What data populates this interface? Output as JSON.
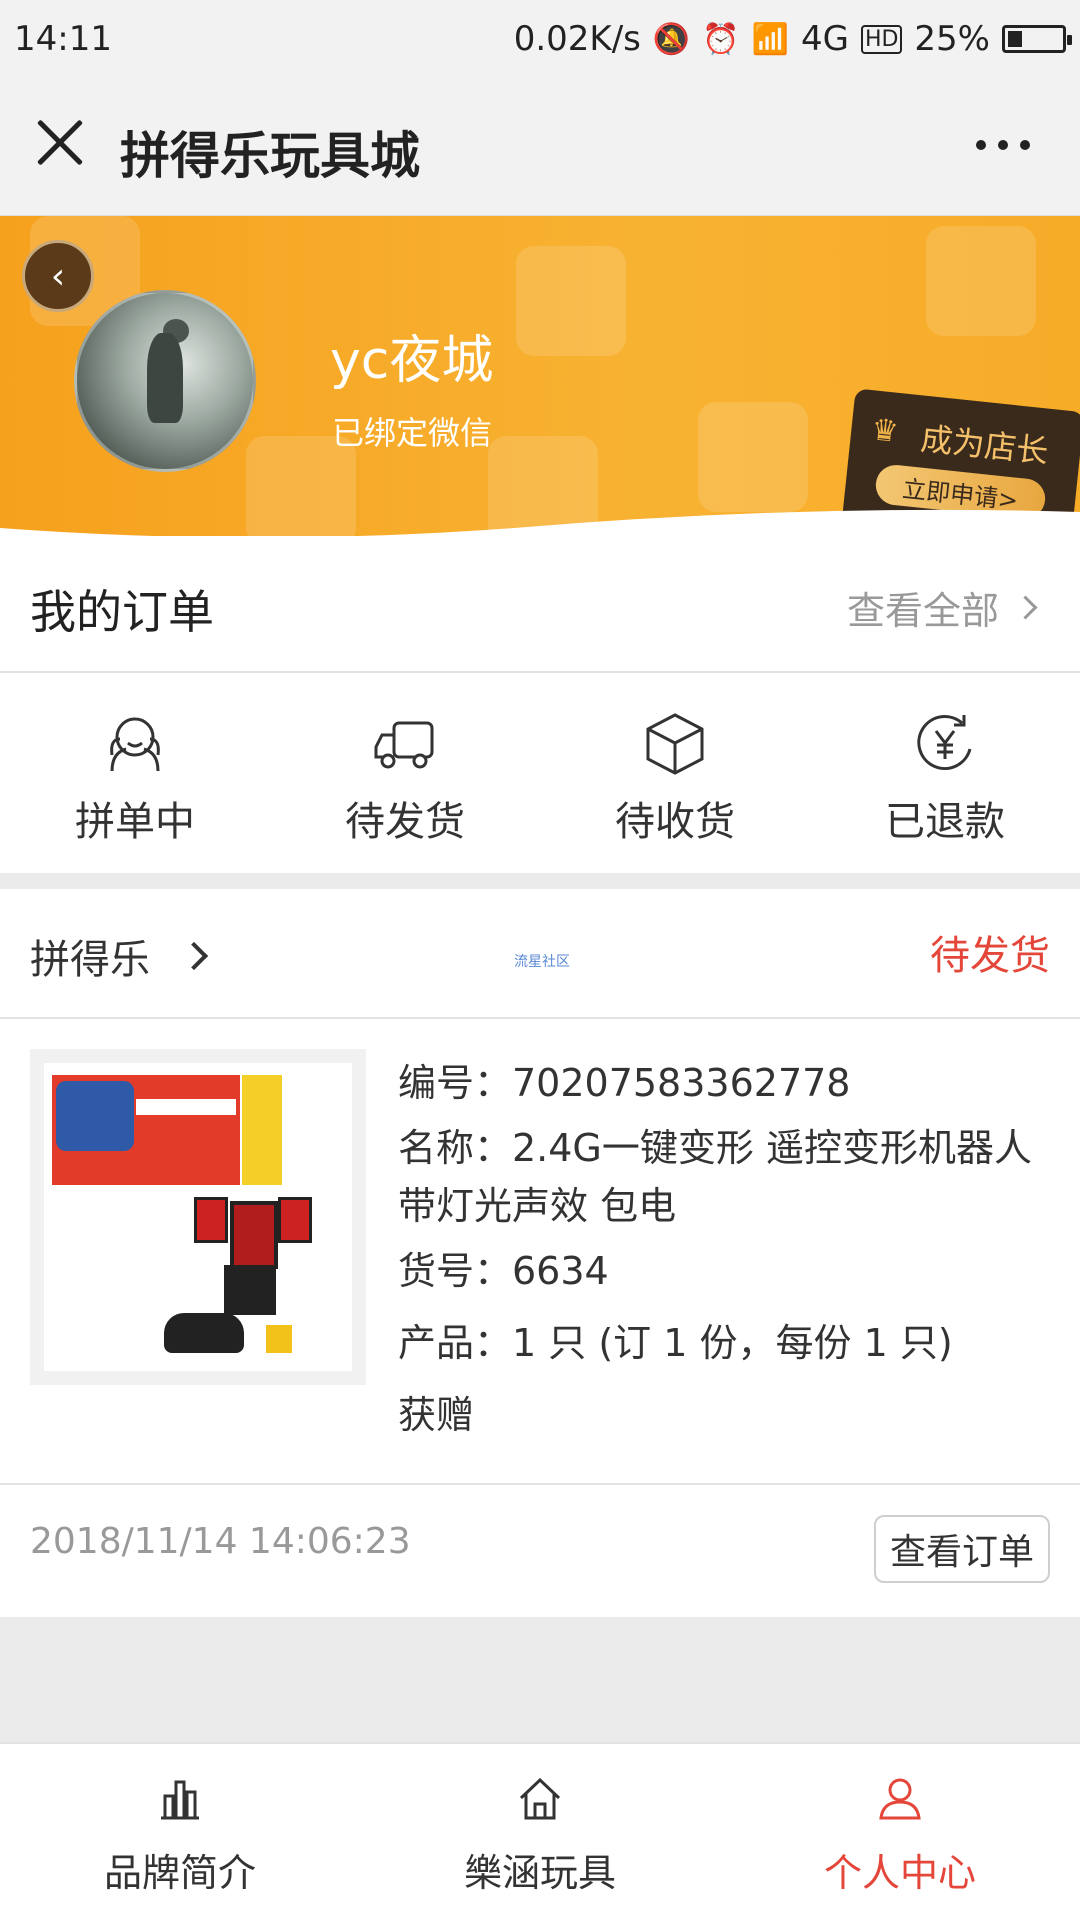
{
  "status_bar": {
    "time": "14:11",
    "speed": "0.02K/s",
    "network": "4G",
    "hd": "HD",
    "battery": "25%"
  },
  "nav": {
    "title": "拼得乐玩具城"
  },
  "profile": {
    "username": "yc夜城",
    "bound_text": "已绑定微信",
    "shop_promo_title": "成为店长",
    "shop_promo_button": "立即申请>"
  },
  "orders": {
    "title": "我的订单",
    "view_all": "查看全部",
    "tabs": [
      {
        "label": "拼单中",
        "icon": "group-buy-icon"
      },
      {
        "label": "待发货",
        "icon": "truck-icon"
      },
      {
        "label": "待收货",
        "icon": "package-icon"
      },
      {
        "label": "已退款",
        "icon": "refund-icon"
      }
    ]
  },
  "order_item": {
    "shop": "拼得乐",
    "watermark": "流星社区",
    "status": "待发货",
    "number": "编号：70207583362778",
    "name_line1": "名称：2.4G一键变形 遥控变形机器人",
    "name_line2": "带灯光声效 包电",
    "sku": "货号：6634",
    "quantity": "产品：1 只 (订 1 份，每份 1 只)",
    "gift": "获赠",
    "date": "2018/11/14 14:06:23",
    "view_order": "查看订单"
  },
  "tabbar": {
    "items": [
      {
        "label": "品牌简介",
        "icon": "chart-icon",
        "active": false
      },
      {
        "label": "樂涵玩具",
        "icon": "home-icon",
        "active": false
      },
      {
        "label": "个人中心",
        "icon": "user-icon",
        "active": true
      }
    ],
    "active_color": "#e4463a"
  },
  "colors": {
    "banner": "#f6a11d",
    "status_red": "#e4463a"
  }
}
